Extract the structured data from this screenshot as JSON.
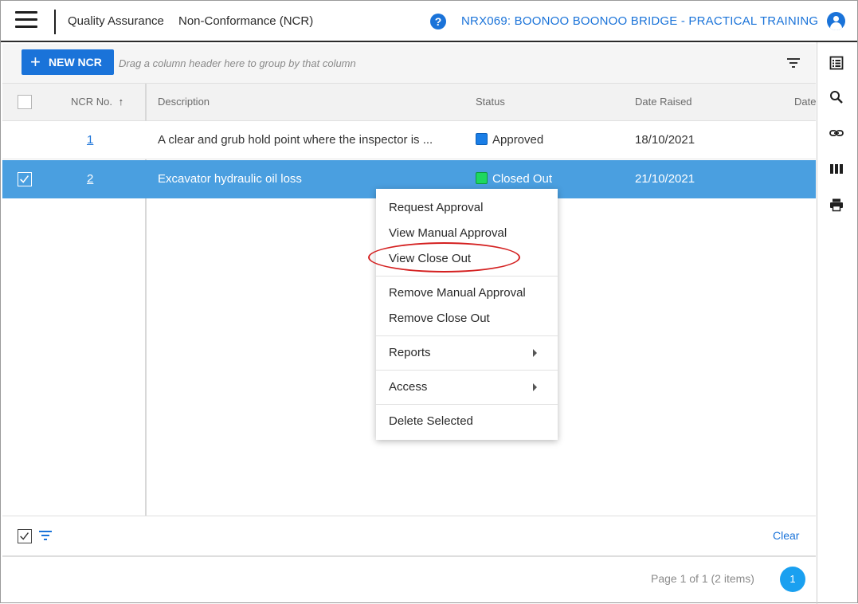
{
  "header": {
    "module": "Quality Assurance",
    "page": "Non-Conformance (NCR)",
    "project": "NRX069: BOONOO BOONOO BRIDGE - PRACTICAL TRAINING"
  },
  "toolbar": {
    "new_button": "NEW NCR",
    "group_hint": "Drag a column header here to group by that column"
  },
  "columns": {
    "ncr_no": "NCR No.",
    "sort_indicator": "↑",
    "description": "Description",
    "status": "Status",
    "date_raised": "Date Raised",
    "date_next": "Date"
  },
  "rows": [
    {
      "ncr_no": "1",
      "description": "A clear and grub hold point where the inspector is ...",
      "status": "Approved",
      "status_color": "#1a7ee6",
      "date_raised": "18/10/2021",
      "selected": false
    },
    {
      "ncr_no": "2",
      "description": "Excavator hydraulic oil loss",
      "status": "Closed Out",
      "status_color": "#1ed760",
      "date_raised": "21/10/2021",
      "selected": true
    }
  ],
  "context_menu": {
    "items": [
      "Request Approval",
      "View Manual Approval",
      "View Close Out",
      "Remove Manual Approval",
      "Remove Close Out",
      "Reports",
      "Access",
      "Delete Selected"
    ]
  },
  "footer": {
    "clear": "Clear",
    "pager": "Page 1 of 1 (2 items)",
    "current_page": "1"
  },
  "sidebar_icons": [
    "list-icon",
    "search-icon",
    "link-icon",
    "columns-icon",
    "print-icon"
  ],
  "colors": {
    "accent": "#1a73d9",
    "selected_row": "#4a9fe0",
    "annotation": "#d42020"
  }
}
